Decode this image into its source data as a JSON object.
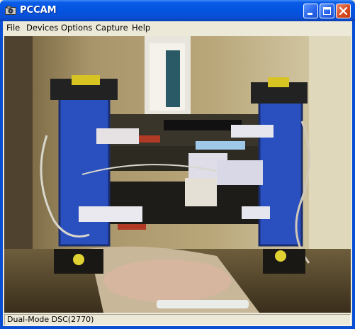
{
  "window": {
    "title": "PCCAM",
    "app_icon": "camera-icon",
    "controls": [
      "minimize-icon",
      "maximize-icon",
      "close-icon"
    ]
  },
  "menu": {
    "items": [
      {
        "label": "File"
      },
      {
        "label": "Devices"
      },
      {
        "label": "Options"
      },
      {
        "label": "Capture"
      },
      {
        "label": "Help"
      }
    ]
  },
  "video": {
    "description_icon": "webcam-video-feed"
  },
  "status": {
    "text": "Dual-Mode DSC(2770)"
  },
  "colors": {
    "titlebar": "#0454e2",
    "close_button": "#d5491f",
    "frame": "#ece9d8"
  }
}
